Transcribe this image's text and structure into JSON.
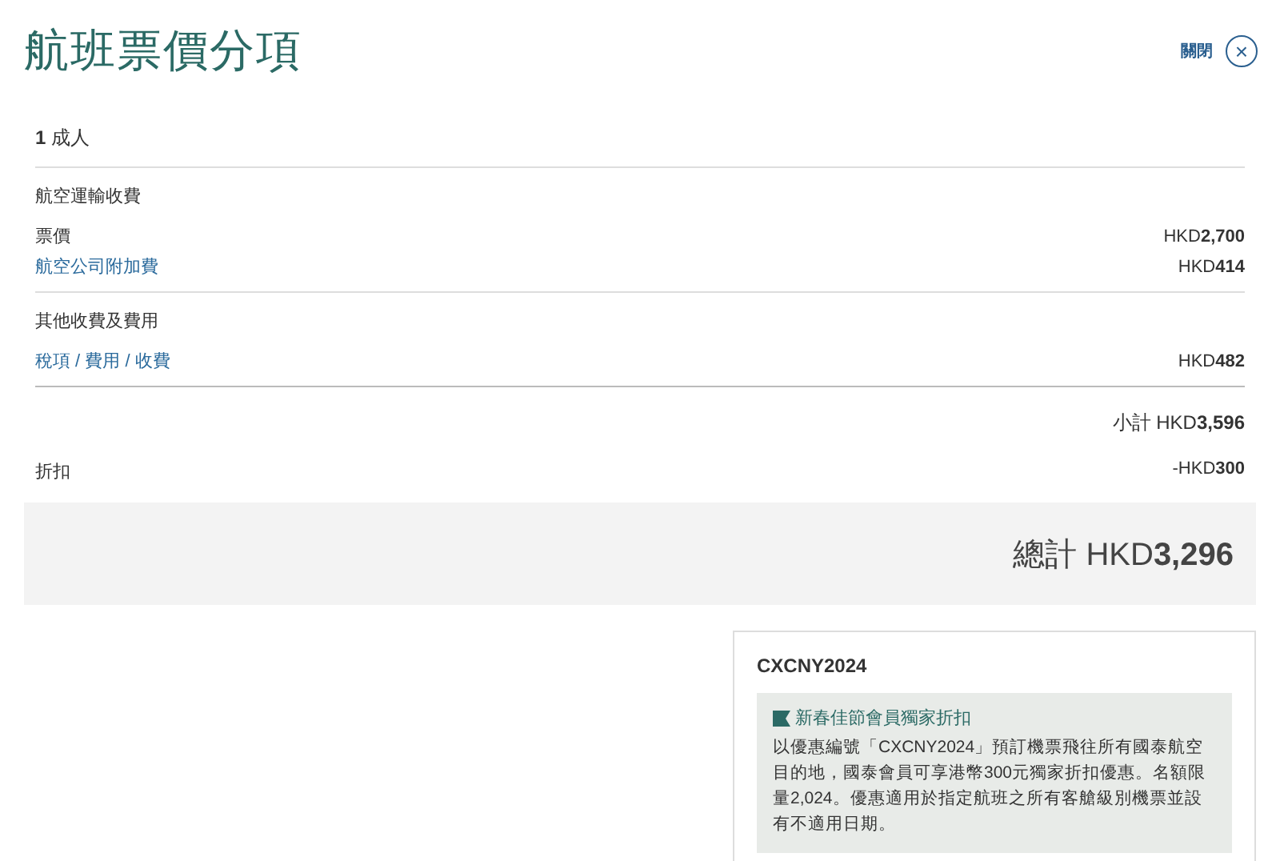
{
  "title": "航班票價分項",
  "close": {
    "label": "關閉",
    "icon": "×"
  },
  "passengers": "**1** 成人",
  "sections": [
    {
      "heading": "航空運輸收費",
      "rows": [
        {
          "label": "票價",
          "kind": "plain",
          "amount": "HKD**2,700**"
        },
        {
          "label": "航空公司附加費",
          "kind": "link",
          "amount": "HKD**414**"
        }
      ]
    },
    {
      "heading": "其他收費及費用",
      "rows": [
        {
          "label": "稅項 / 費用 / 收費",
          "kind": "link",
          "amount": "HKD**482**"
        }
      ]
    }
  ],
  "subtotal": "小計 HKD**3,596**",
  "discount": {
    "label": "折扣",
    "amount": "-HKD**300**"
  },
  "total": "總計 HKD**3,296**",
  "promo": {
    "code": "CXCNY2024",
    "title": "新春佳節會員獨家折扣",
    "text": "以優惠編號「CXCNY2024」預訂機票飛往所有國泰航空目的地，國泰會員可享港幣300元獨家折扣優惠。名額限量2,024。優惠適用於指定航班之所有客艙級別機票並設有不適用日期。"
  }
}
